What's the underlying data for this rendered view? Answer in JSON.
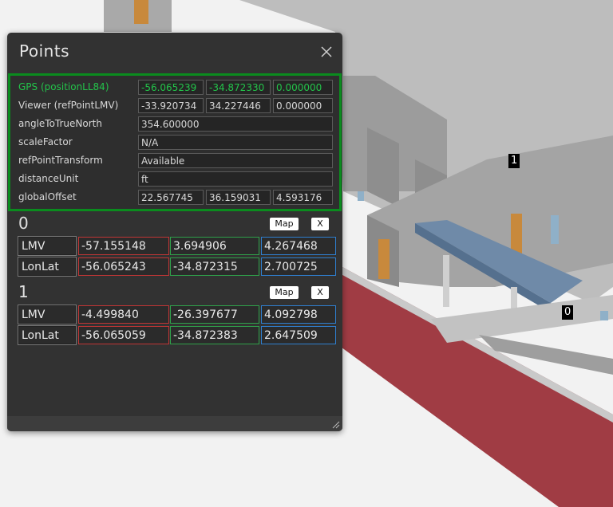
{
  "panel": {
    "title": "Points",
    "info": [
      {
        "label": "GPS (positionLL84)",
        "values": [
          "-56.065239",
          "-34.872330",
          "0.000000"
        ],
        "highlight": true
      },
      {
        "label": "Viewer (refPointLMV)",
        "values": [
          "-33.920734",
          "34.227446",
          "0.000000"
        ]
      },
      {
        "label": "angleToTrueNorth",
        "value": "354.600000"
      },
      {
        "label": "scaleFactor",
        "value": "N/A"
      },
      {
        "label": "refPointTransform",
        "value": "Available"
      },
      {
        "label": "distanceUnit",
        "value": "ft"
      },
      {
        "label": "globalOffset",
        "values": [
          "22.567745",
          "36.159031",
          "4.593176"
        ]
      }
    ],
    "points": [
      {
        "id": "0",
        "map_label": "Map",
        "remove_label": "X",
        "lmv_label": "LMV",
        "lmv": [
          "-57.155148",
          "3.694906",
          "4.267468"
        ],
        "lonlat_label": "LonLat",
        "lonlat": [
          "-56.065243",
          "-34.872315",
          "2.700725"
        ]
      },
      {
        "id": "1",
        "map_label": "Map",
        "remove_label": "X",
        "lmv_label": "LMV",
        "lmv": [
          "-4.499840",
          "-26.397677",
          "4.092798"
        ],
        "lonlat_label": "LonLat",
        "lonlat": [
          "-56.065059",
          "-34.872383",
          "2.647509"
        ]
      }
    ]
  },
  "scene": {
    "marker_1": "1",
    "marker_0": "0"
  },
  "colors": {
    "panel_bg": "#323232",
    "highlight_green": "#23c34a",
    "box_border_green": "#0a8c1e",
    "x_axis_red": "#c03535",
    "y_axis_green": "#2fa14a",
    "z_axis_blue": "#2f7fcf",
    "wall_red": "#a03c44"
  }
}
